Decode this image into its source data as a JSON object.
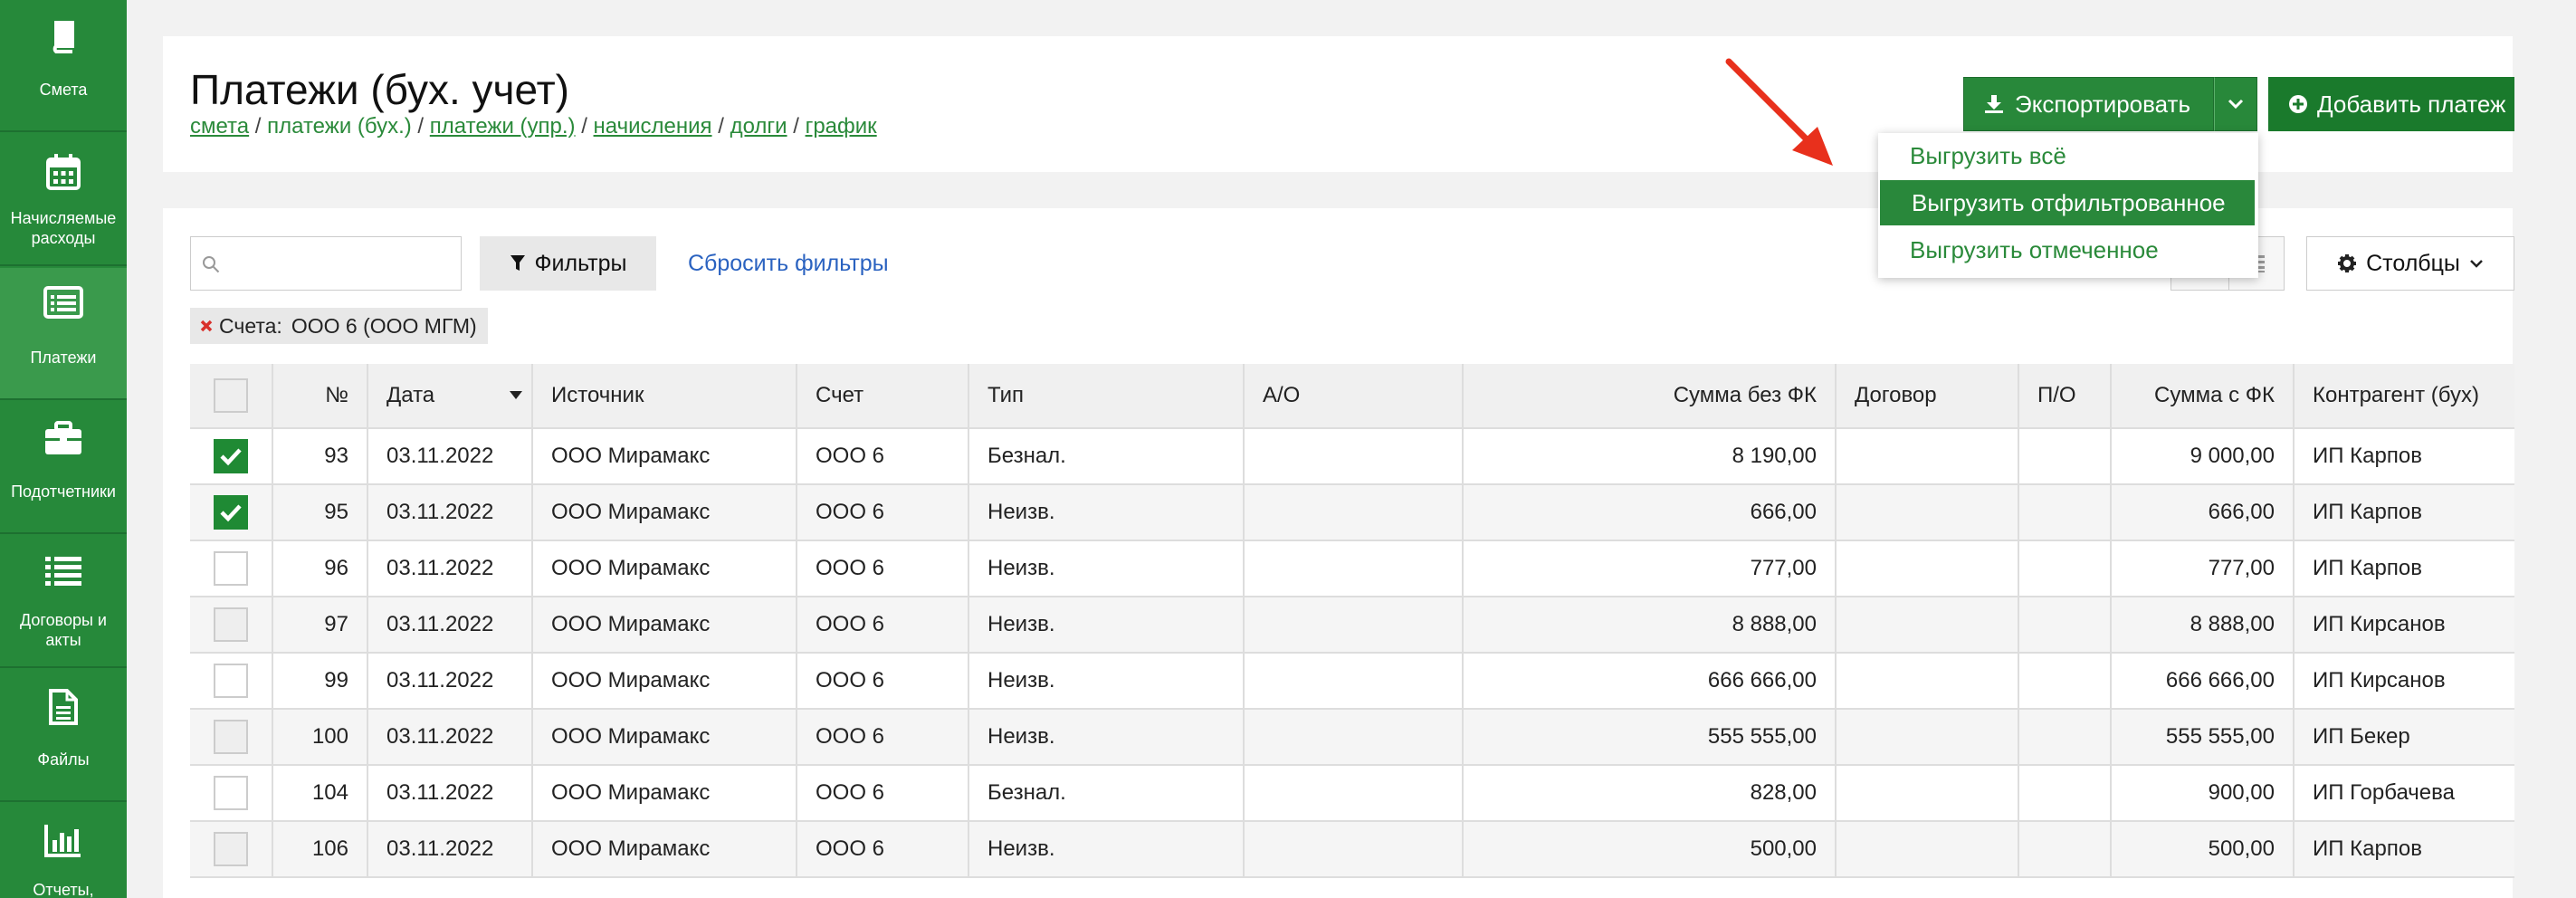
{
  "sidebar": {
    "items": [
      {
        "label": "Смета",
        "icon": "book-icon"
      },
      {
        "label": "Начисляемые расходы",
        "icon": "calendar-icon"
      },
      {
        "label": "Платежи",
        "icon": "list-card-icon"
      },
      {
        "label": "Подотчетники",
        "icon": "briefcase-icon"
      },
      {
        "label": "Договоры и акты",
        "icon": "list-icon"
      },
      {
        "label": "Файлы",
        "icon": "file-icon"
      },
      {
        "label": "Отчеты,",
        "icon": "bar-chart-icon"
      }
    ]
  },
  "header": {
    "title": "Платежи (бух. учет)",
    "breadcrumb": {
      "smeta": "смета",
      "current": "платежи (бух.)",
      "upr": "платежи (упр.)",
      "nach": "начисления",
      "dolgi": "долги",
      "grafik": "график",
      "sep": " / "
    },
    "export_label": "Экспортировать",
    "add_label": "Добавить платеж"
  },
  "export_menu": {
    "items": [
      "Выгрузить всё",
      "Выгрузить отфильтрованное",
      "Выгрузить отмеченное"
    ],
    "active_index": 1
  },
  "toolbar": {
    "search_placeholder": "",
    "filters_label": "Фильтры",
    "reset_label": "Сбросить фильтры",
    "columns_label": "Столбцы"
  },
  "active_filter": {
    "label": "Счета:",
    "value": "ООО 6 (ООО МГМ)"
  },
  "table": {
    "columns": [
      "№",
      "Дата",
      "Источник",
      "Счет",
      "Тип",
      "А/О",
      "Сумма без ФК",
      "Договор",
      "П/О",
      "Сумма с ФК",
      "Контрагент (бух)"
    ],
    "rows": [
      {
        "checked": true,
        "num": "93",
        "date": "03.11.2022",
        "source": "ООО Мирамакс",
        "account": "ООО 6",
        "type": "Безнал.",
        "ao": "",
        "sum_no_fk": "8 190,00",
        "contract": "",
        "po": "",
        "sum_fk": "9 000,00",
        "counterparty": "ИП Карпов"
      },
      {
        "checked": true,
        "num": "95",
        "date": "03.11.2022",
        "source": "ООО Мирамакс",
        "account": "ООО 6",
        "type": "Неизв.",
        "ao": "",
        "sum_no_fk": "666,00",
        "contract": "",
        "po": "",
        "sum_fk": "666,00",
        "counterparty": "ИП Карпов"
      },
      {
        "checked": false,
        "num": "96",
        "date": "03.11.2022",
        "source": "ООО Мирамакс",
        "account": "ООО 6",
        "type": "Неизв.",
        "ao": "",
        "sum_no_fk": "777,00",
        "contract": "",
        "po": "",
        "sum_fk": "777,00",
        "counterparty": "ИП Карпов"
      },
      {
        "checked": false,
        "num": "97",
        "date": "03.11.2022",
        "source": "ООО Мирамакс",
        "account": "ООО 6",
        "type": "Неизв.",
        "ao": "",
        "sum_no_fk": "8 888,00",
        "contract": "",
        "po": "",
        "sum_fk": "8 888,00",
        "counterparty": "ИП Кирсанов"
      },
      {
        "checked": false,
        "num": "99",
        "date": "03.11.2022",
        "source": "ООО Мирамакс",
        "account": "ООО 6",
        "type": "Неизв.",
        "ao": "",
        "sum_no_fk": "666 666,00",
        "contract": "",
        "po": "",
        "sum_fk": "666 666,00",
        "counterparty": "ИП Кирсанов"
      },
      {
        "checked": false,
        "num": "100",
        "date": "03.11.2022",
        "source": "ООО Мирамакс",
        "account": "ООО 6",
        "type": "Неизв.",
        "ao": "",
        "sum_no_fk": "555 555,00",
        "contract": "",
        "po": "",
        "sum_fk": "555 555,00",
        "counterparty": "ИП Бекер"
      },
      {
        "checked": false,
        "num": "104",
        "date": "03.11.2022",
        "source": "ООО Мирамакс",
        "account": "ООО 6",
        "type": "Безнал.",
        "ao": "",
        "sum_no_fk": "828,00",
        "contract": "",
        "po": "",
        "sum_fk": "900,00",
        "counterparty": "ИП Горбачева"
      },
      {
        "checked": false,
        "num": "106",
        "date": "03.11.2022",
        "source": "ООО Мирамакс",
        "account": "ООО 6",
        "type": "Неизв.",
        "ao": "",
        "sum_no_fk": "500,00",
        "contract": "",
        "po": "",
        "sum_fk": "500,00",
        "counterparty": "ИП Карпов"
      }
    ]
  },
  "colors": {
    "brand_green": "#26893a",
    "link_blue": "#2a62c0",
    "arrow_red": "#e8301c"
  }
}
